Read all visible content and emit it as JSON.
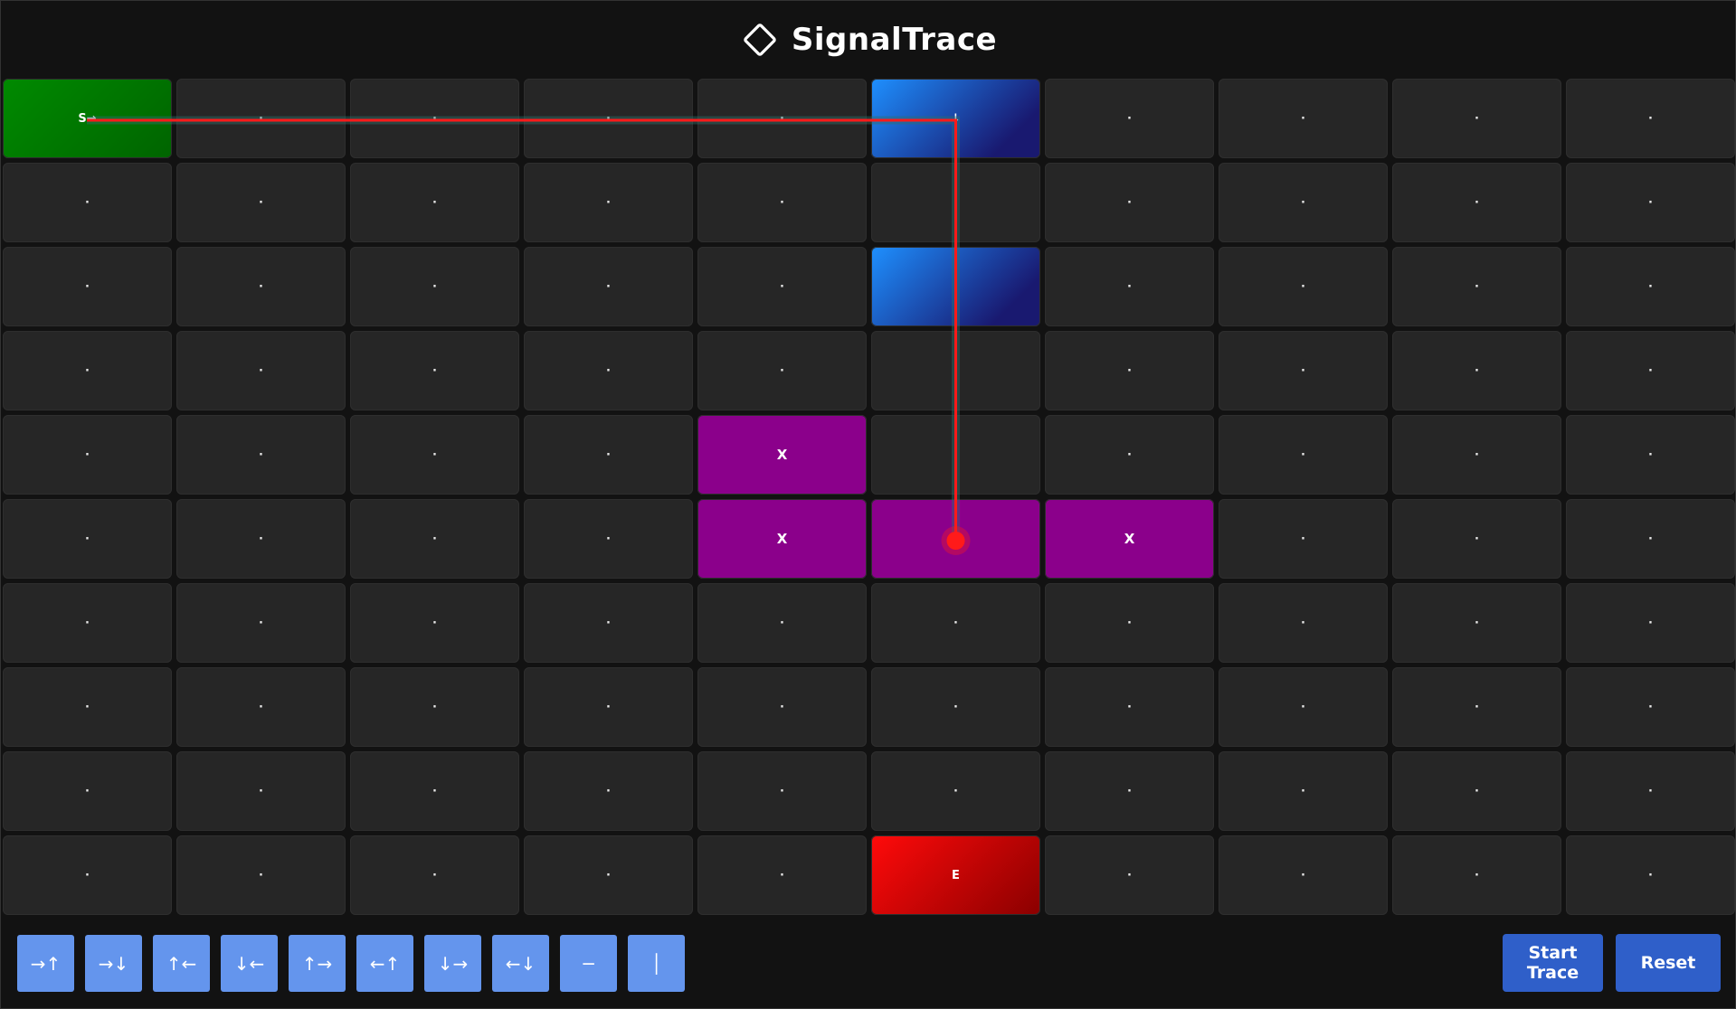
{
  "app": {
    "title": "SignalTrace",
    "logo_icon": "diamond-icon"
  },
  "board": {
    "rows": [
      [
        "S→",
        "·",
        "·",
        "·",
        "·",
        "↓",
        "·",
        "·",
        "·",
        "·"
      ],
      [
        "·",
        "·",
        "·",
        "·",
        "·",
        "·",
        "·",
        "·",
        "·",
        "·"
      ],
      [
        "·",
        "·",
        "·",
        "·",
        "·",
        "",
        "·",
        "·",
        "·",
        "·"
      ],
      [
        "·",
        "·",
        "·",
        "·",
        "·",
        "·",
        "·",
        "·",
        "·",
        "·"
      ],
      [
        "·",
        "·",
        "·",
        "·",
        "X",
        "·",
        "·",
        "·",
        "·",
        "·"
      ],
      [
        "·",
        "·",
        "·",
        "·",
        "X",
        "",
        "X",
        "·",
        "·",
        "·"
      ],
      [
        "·",
        "·",
        "·",
        "·",
        "·",
        "·",
        "·",
        "·",
        "·",
        "·"
      ],
      [
        "·",
        "·",
        "·",
        "·",
        "·",
        "·",
        "·",
        "·",
        "·",
        "·"
      ],
      [
        "·",
        "·",
        "·",
        "·",
        "·",
        "·",
        "·",
        "·",
        "·",
        "·"
      ],
      [
        "·",
        "·",
        "·",
        "·",
        "·",
        "E",
        "·",
        "·",
        "·",
        "·"
      ]
    ],
    "types": [
      [
        "start",
        "empty",
        "empty",
        "empty",
        "empty",
        "pipe",
        "empty",
        "empty",
        "empty",
        "empty"
      ],
      [
        "empty",
        "empty",
        "empty",
        "empty",
        "empty",
        "empty",
        "empty",
        "empty",
        "empty",
        "empty"
      ],
      [
        "empty",
        "empty",
        "empty",
        "empty",
        "empty",
        "pipe",
        "empty",
        "empty",
        "empty",
        "empty"
      ],
      [
        "empty",
        "empty",
        "empty",
        "empty",
        "empty",
        "empty",
        "empty",
        "empty",
        "empty",
        "empty"
      ],
      [
        "empty",
        "empty",
        "empty",
        "empty",
        "block",
        "empty",
        "empty",
        "empty",
        "empty",
        "empty"
      ],
      [
        "empty",
        "empty",
        "empty",
        "empty",
        "block",
        "block",
        "block",
        "empty",
        "empty",
        "empty"
      ],
      [
        "empty",
        "empty",
        "empty",
        "empty",
        "empty",
        "empty",
        "empty",
        "empty",
        "empty",
        "empty"
      ],
      [
        "empty",
        "empty",
        "empty",
        "empty",
        "empty",
        "empty",
        "empty",
        "empty",
        "empty",
        "empty"
      ],
      [
        "empty",
        "empty",
        "empty",
        "empty",
        "empty",
        "empty",
        "empty",
        "empty",
        "empty",
        "empty"
      ],
      [
        "empty",
        "empty",
        "empty",
        "empty",
        "empty",
        "end",
        "empty",
        "empty",
        "empty",
        "empty"
      ]
    ],
    "colors": {
      "start": "#008000",
      "end": "#ff0000",
      "pipe": "#1e90ff",
      "block": "#8b008b",
      "empty": "#262626",
      "trace": "#ff1a1a"
    },
    "trace_path": [
      [
        0,
        0
      ],
      [
        0,
        5
      ],
      [
        5,
        5
      ]
    ]
  },
  "toolbar": {
    "tools": [
      "→↑",
      "→↓",
      "↑←",
      "↓←",
      "↑→",
      "←↑",
      "↓→",
      "←↓",
      "─",
      "│"
    ],
    "start_label": "Start Trace",
    "reset_label": "Reset"
  }
}
